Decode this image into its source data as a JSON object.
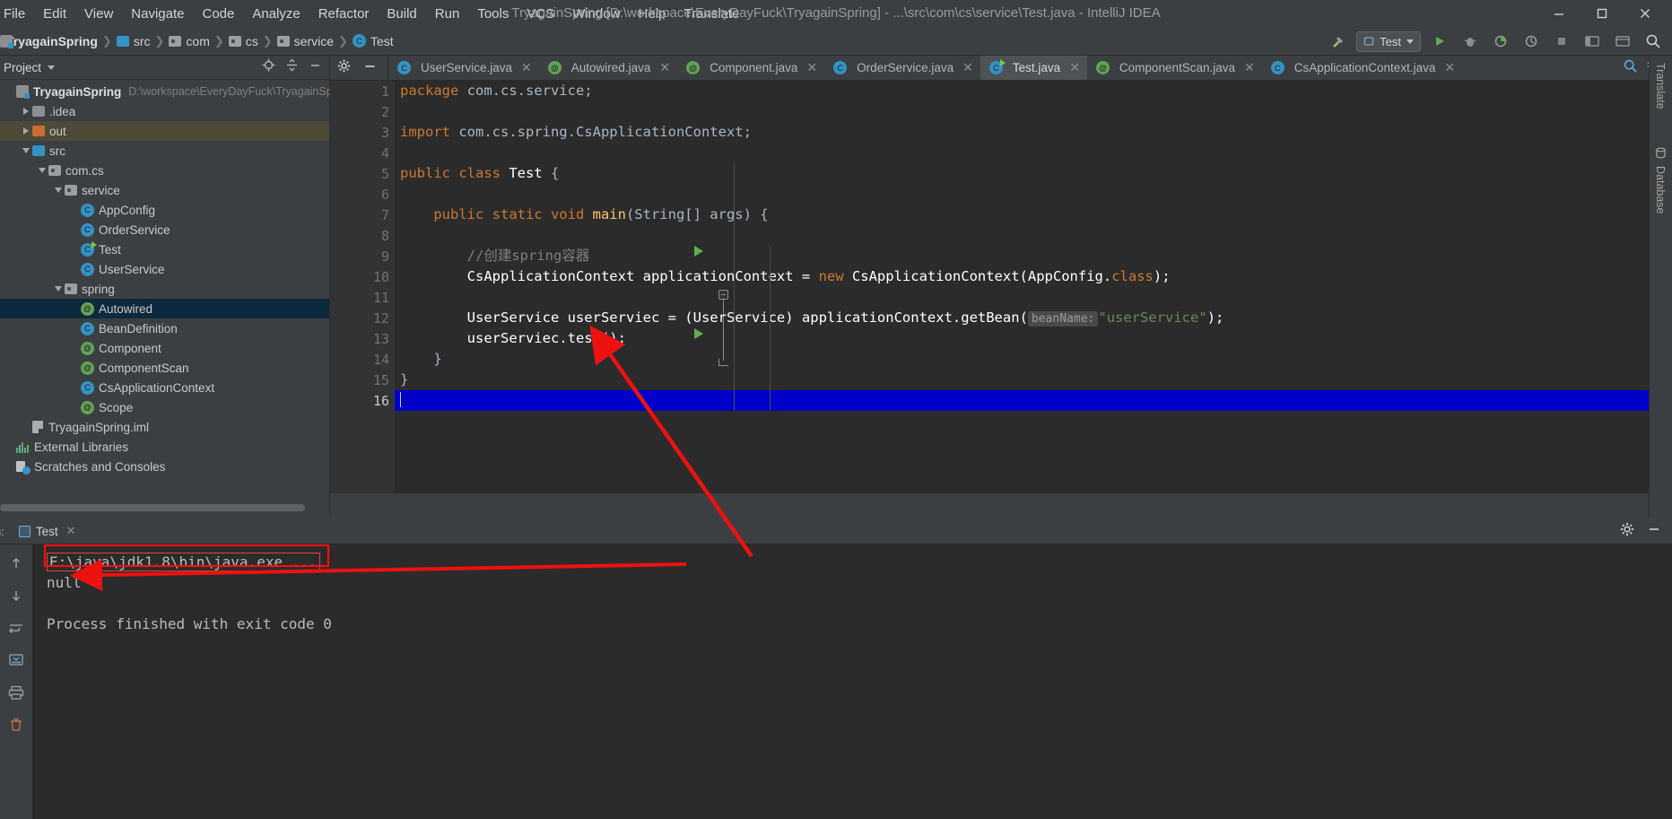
{
  "window": {
    "title": "TryagainSpring [D:\\workspace\\EveryDayFuck\\TryagainSpring] - ...\\src\\com\\cs\\service\\Test.java - IntelliJ IDEA",
    "minimize_label": "—",
    "maximize_label": "❑",
    "close_label": "✕"
  },
  "menu": [
    {
      "label": "File"
    },
    {
      "label": "Edit"
    },
    {
      "label": "View"
    },
    {
      "label": "Navigate"
    },
    {
      "label": "Code"
    },
    {
      "label": "Analyze"
    },
    {
      "label": "Refactor"
    },
    {
      "label": "Build"
    },
    {
      "label": "Run"
    },
    {
      "label": "Tools"
    },
    {
      "label": "VCS"
    },
    {
      "label": "Window"
    },
    {
      "label": "Help"
    },
    {
      "label": "Translate"
    }
  ],
  "breadcrumb": [
    {
      "label": "TryagainSpring",
      "icon": "module-icon"
    },
    {
      "label": "src",
      "icon": "source-folder-icon"
    },
    {
      "label": "com",
      "icon": "package-icon"
    },
    {
      "label": "cs",
      "icon": "package-icon"
    },
    {
      "label": "service",
      "icon": "package-icon"
    },
    {
      "label": "Test",
      "icon": "class-icon"
    }
  ],
  "navbar_right": {
    "run_config": "Test",
    "build_icon": "hammer-icon",
    "run_icon": "run-icon",
    "debug_icon": "debug-icon",
    "coverage_icon": "coverage-icon",
    "profile_icon": "profile-icon",
    "stop_icon": "stop-icon",
    "layout_icon": "layout-icon",
    "preview_icon": "preview-icon",
    "search_icon": "search-icon"
  },
  "sidebar": {
    "title": "Project",
    "locate_icon": "locate-icon",
    "collapse_icon": "collapse-all-icon",
    "minimize_icon": "minimize-icon",
    "tree": [
      {
        "label": "TryagainSpring",
        "path": "D:\\workspace\\EveryDayFuck\\TryagainSpri",
        "depth": 0,
        "icon": "module-icon",
        "arrow": "none",
        "state": "root"
      },
      {
        "label": ".idea",
        "depth": 1,
        "icon": "folder-icon",
        "arrow": "right",
        "state": "normal"
      },
      {
        "label": "out",
        "depth": 1,
        "icon": "folder-orange-icon",
        "arrow": "right",
        "state": "highlight"
      },
      {
        "label": "src",
        "depth": 1,
        "icon": "source-folder-icon",
        "arrow": "down",
        "state": "normal"
      },
      {
        "label": "com.cs",
        "depth": 2,
        "icon": "package-icon",
        "arrow": "down",
        "state": "normal"
      },
      {
        "label": "service",
        "depth": 3,
        "icon": "package-icon",
        "arrow": "down",
        "state": "normal"
      },
      {
        "label": "AppConfig",
        "depth": 4,
        "icon": "class-icon",
        "arrow": "none",
        "state": "normal"
      },
      {
        "label": "OrderService",
        "depth": 4,
        "icon": "class-icon",
        "arrow": "none",
        "state": "normal"
      },
      {
        "label": "Test",
        "depth": 4,
        "icon": "class-runnable-icon",
        "arrow": "none",
        "state": "normal"
      },
      {
        "label": "UserService",
        "depth": 4,
        "icon": "class-icon",
        "arrow": "none",
        "state": "normal"
      },
      {
        "label": "spring",
        "depth": 3,
        "icon": "package-icon",
        "arrow": "down",
        "state": "normal"
      },
      {
        "label": "Autowired",
        "depth": 4,
        "icon": "annotation-icon",
        "arrow": "none",
        "state": "selected"
      },
      {
        "label": "BeanDefinition",
        "depth": 4,
        "icon": "class-icon",
        "arrow": "none",
        "state": "normal"
      },
      {
        "label": "Component",
        "depth": 4,
        "icon": "annotation-icon",
        "arrow": "none",
        "state": "normal"
      },
      {
        "label": "ComponentScan",
        "depth": 4,
        "icon": "annotation-icon",
        "arrow": "none",
        "state": "normal"
      },
      {
        "label": "CsApplicationContext",
        "depth": 4,
        "icon": "class-icon",
        "arrow": "none",
        "state": "normal"
      },
      {
        "label": "Scope",
        "depth": 4,
        "icon": "annotation-icon",
        "arrow": "none",
        "state": "normal"
      },
      {
        "label": "TryagainSpring.iml",
        "depth": 1,
        "icon": "iml-file-icon",
        "arrow": "none",
        "state": "normal"
      },
      {
        "label": "External Libraries",
        "depth": 0,
        "icon": "libraries-icon",
        "arrow": "none",
        "state": "normal"
      },
      {
        "label": "Scratches and Consoles",
        "depth": 0,
        "icon": "scratches-icon",
        "arrow": "none",
        "state": "normal"
      }
    ]
  },
  "editor_tabs": [
    {
      "label": "UserService.java",
      "icon": "class-icon",
      "active": false
    },
    {
      "label": "Autowired.java",
      "icon": "annotation-icon",
      "active": false
    },
    {
      "label": "Component.java",
      "icon": "annotation-icon",
      "active": false
    },
    {
      "label": "OrderService.java",
      "icon": "class-icon",
      "active": false
    },
    {
      "label": "Test.java",
      "icon": "class-runnable-icon",
      "active": true
    },
    {
      "label": "ComponentScan.java",
      "icon": "annotation-icon",
      "active": false
    },
    {
      "label": "CsApplicationContext.java",
      "icon": "class-icon",
      "active": false
    }
  ],
  "editor": {
    "line_numbers": [
      "1",
      "2",
      "3",
      "4",
      "5",
      "6",
      "7",
      "8",
      "9",
      "10",
      "11",
      "12",
      "13",
      "14",
      "15",
      "16"
    ],
    "current_line": 16,
    "lines": [
      {
        "n": 1,
        "tokens": [
          {
            "t": "package ",
            "c": "k"
          },
          {
            "t": "com.cs.service;",
            "c": "t"
          }
        ]
      },
      {
        "n": 2,
        "tokens": []
      },
      {
        "n": 3,
        "tokens": [
          {
            "t": "import ",
            "c": "k"
          },
          {
            "t": "com.cs.spring.CsApplicationContext;",
            "c": "t"
          }
        ]
      },
      {
        "n": 4,
        "tokens": []
      },
      {
        "n": 5,
        "tokens": [
          {
            "t": "public class ",
            "c": "k"
          },
          {
            "t": "Test",
            "c": "ty"
          },
          {
            "t": " {",
            "c": "t"
          }
        ]
      },
      {
        "n": 6,
        "tokens": []
      },
      {
        "n": 7,
        "tokens": [
          {
            "t": "    ",
            "c": "t"
          },
          {
            "t": "public static void ",
            "c": "k"
          },
          {
            "t": "main",
            "c": "m"
          },
          {
            "t": "(String[] args) {",
            "c": "t"
          }
        ]
      },
      {
        "n": 8,
        "tokens": []
      },
      {
        "n": 9,
        "tokens": [
          {
            "t": "        ",
            "c": "t"
          },
          {
            "t": "//创建spring容器",
            "c": "cm"
          }
        ]
      },
      {
        "n": 10,
        "tokens": [
          {
            "t": "        ",
            "c": "t"
          },
          {
            "t": "CsApplicationContext applicationContext = ",
            "c": "ty"
          },
          {
            "t": "new ",
            "c": "k"
          },
          {
            "t": "CsApplicationContext(AppConfig.",
            "c": "ty"
          },
          {
            "t": "class",
            "c": "k"
          },
          {
            "t": ");",
            "c": "ty"
          }
        ]
      },
      {
        "n": 11,
        "tokens": []
      },
      {
        "n": 12,
        "tokens": [
          {
            "t": "        ",
            "c": "t"
          },
          {
            "t": "UserService userServiec = (UserService) applicationContext.",
            "c": "ty"
          },
          {
            "t": "getBean",
            "c": "ty"
          },
          {
            "t": "(",
            "c": "ty"
          },
          {
            "t": "beanName:",
            "c": "hint"
          },
          {
            "t": "\"userService\"",
            "c": "s"
          },
          {
            "t": ");",
            "c": "ty"
          }
        ]
      },
      {
        "n": 13,
        "tokens": [
          {
            "t": "        ",
            "c": "t"
          },
          {
            "t": "userServiec.",
            "c": "ty"
          },
          {
            "t": "test",
            "c": "ty"
          },
          {
            "t": "();",
            "c": "ty"
          }
        ]
      },
      {
        "n": 14,
        "tokens": [
          {
            "t": "    }",
            "c": "t"
          }
        ]
      },
      {
        "n": 15,
        "tokens": [
          {
            "t": "}",
            "c": "t"
          }
        ]
      },
      {
        "n": 16,
        "tokens": []
      }
    ],
    "run_markers": [
      5,
      7
    ],
    "fold_marker_line": 7,
    "fold_end_line": 14,
    "inspection_status": "ok"
  },
  "right_strip": [
    {
      "label": "Translate",
      "icon": "translate-icon"
    },
    {
      "label": "Database",
      "icon": "database-icon"
    }
  ],
  "run_window": {
    "prefix": "n:",
    "tab_label": "Test",
    "tab_close": "✕",
    "settings_icon": "gear-icon",
    "minimize_icon": "minimize-icon",
    "toolbar": [
      {
        "icon": "arrow-up-icon"
      },
      {
        "icon": "arrow-down-icon"
      },
      {
        "icon": "soft-wrap-icon"
      },
      {
        "icon": "scroll-end-icon"
      },
      {
        "icon": "print-icon"
      },
      {
        "icon": "trash-icon"
      }
    ],
    "console_lines": [
      {
        "text": "E:\\java\\jdk1.8\\bin\\java.exe ...",
        "boxed": true
      },
      {
        "text": "null",
        "boxed": false
      },
      {
        "text": "",
        "boxed": false
      },
      {
        "text": "Process finished with exit code 0",
        "boxed": false
      }
    ]
  },
  "annotations": {
    "arrow_color": "#ee1111",
    "arrow1": "points from console 'null' output up-left to code line 13 test() call",
    "arrow2": "points from right of console area left to the 'null' output"
  },
  "colors": {
    "bg_chrome": "#3c3f41",
    "bg_editor": "#2b2b2b",
    "accent_blue": "#3592c4",
    "accent_green": "#62a356",
    "keyword_orange": "#cc7832",
    "string_green": "#6a8759",
    "method_yellow": "#ffc66d",
    "selection_blue": "#0d293e",
    "current_line": "#0000c8",
    "annotation_red": "#ee1111"
  }
}
